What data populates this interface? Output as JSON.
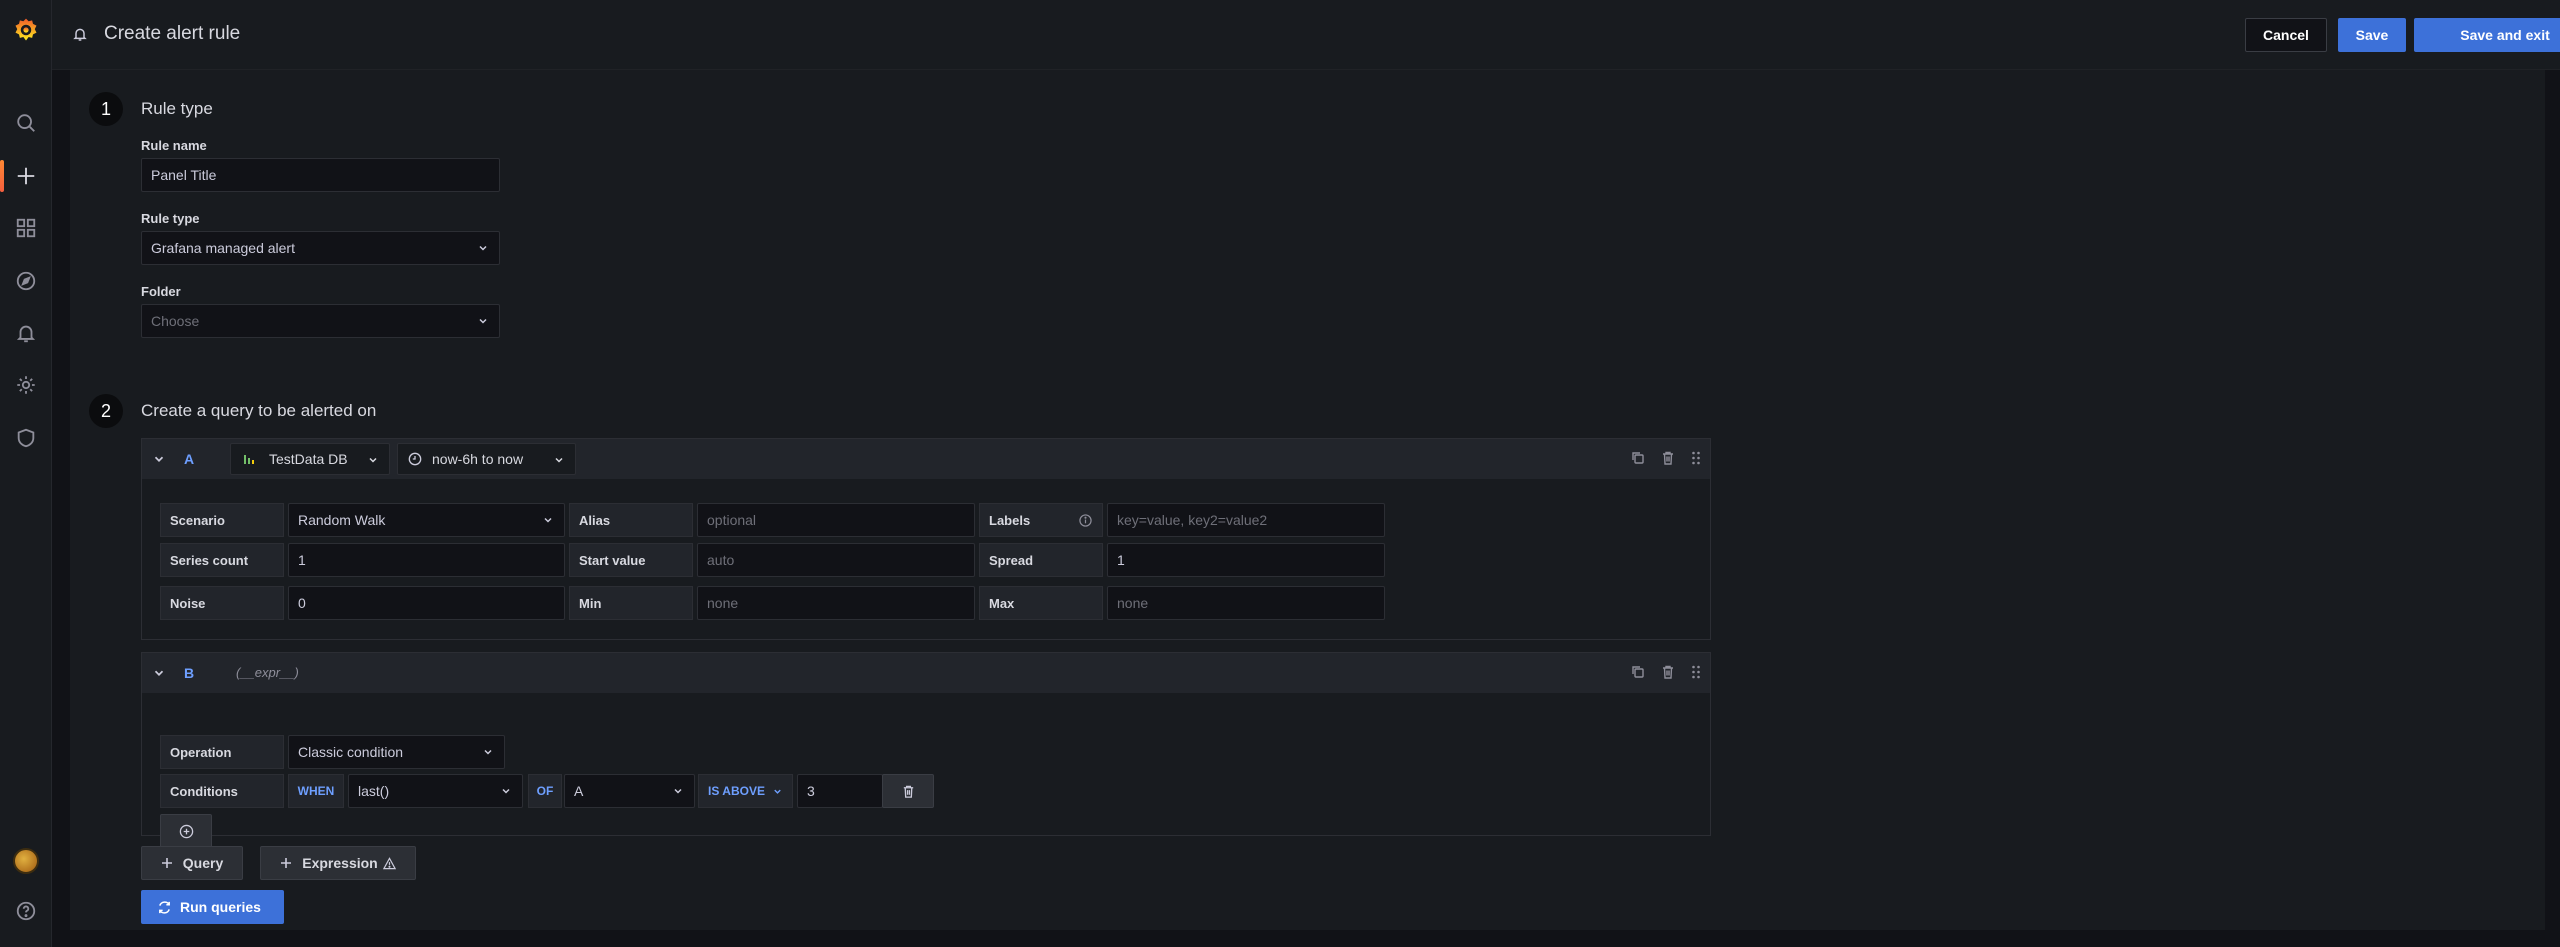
{
  "header": {
    "title": "Create alert rule",
    "cancel_label": "Cancel",
    "save_label": "Save",
    "save_exit_label": "Save and exit"
  },
  "sidebar": {
    "icons": [
      "grafana-logo-icon",
      "search-icon",
      "plus-icon",
      "dashboards-icon",
      "explore-icon",
      "alerting-icon",
      "gear-icon",
      "shield-icon",
      "avatar",
      "help-icon"
    ]
  },
  "step1": {
    "number": "1",
    "title": "Rule type",
    "rule_name_label": "Rule name",
    "rule_name_value": "Panel Title",
    "rule_type_label": "Rule type",
    "rule_type_value": "Grafana managed alert",
    "folder_label": "Folder",
    "folder_placeholder": "Choose"
  },
  "step2": {
    "number": "2",
    "title": "Create a query to be alerted on"
  },
  "queryA": {
    "name": "A",
    "datasource": "TestData DB",
    "time_range": "now-6h to now",
    "scenario_label": "Scenario",
    "scenario_value": "Random Walk",
    "alias_label": "Alias",
    "alias_placeholder": "optional",
    "labels_label": "Labels",
    "labels_placeholder": "key=value, key2=value2",
    "series_count_label": "Series count",
    "series_count_value": "1",
    "start_value_label": "Start value",
    "start_value_placeholder": "auto",
    "spread_label": "Spread",
    "spread_value": "1",
    "noise_label": "Noise",
    "noise_value": "0",
    "min_label": "Min",
    "min_placeholder": "none",
    "max_label": "Max",
    "max_placeholder": "none"
  },
  "queryB": {
    "name": "B",
    "expr": "(__expr__)",
    "operation_label": "Operation",
    "operation_value": "Classic condition",
    "conditions_label": "Conditions",
    "when_kw": "WHEN",
    "reducer_value": "last()",
    "of_kw": "OF",
    "query_ref_value": "A",
    "evaluator": "IS ABOVE",
    "threshold_value": "3"
  },
  "actions": {
    "add_query_label": "Query",
    "add_expression_label": "Expression",
    "run_queries_label": "Run queries"
  },
  "colors": {
    "accent": "#3d71d9",
    "query_name": "#6e9fff",
    "background": "#111217",
    "panel": "#181b1f"
  }
}
